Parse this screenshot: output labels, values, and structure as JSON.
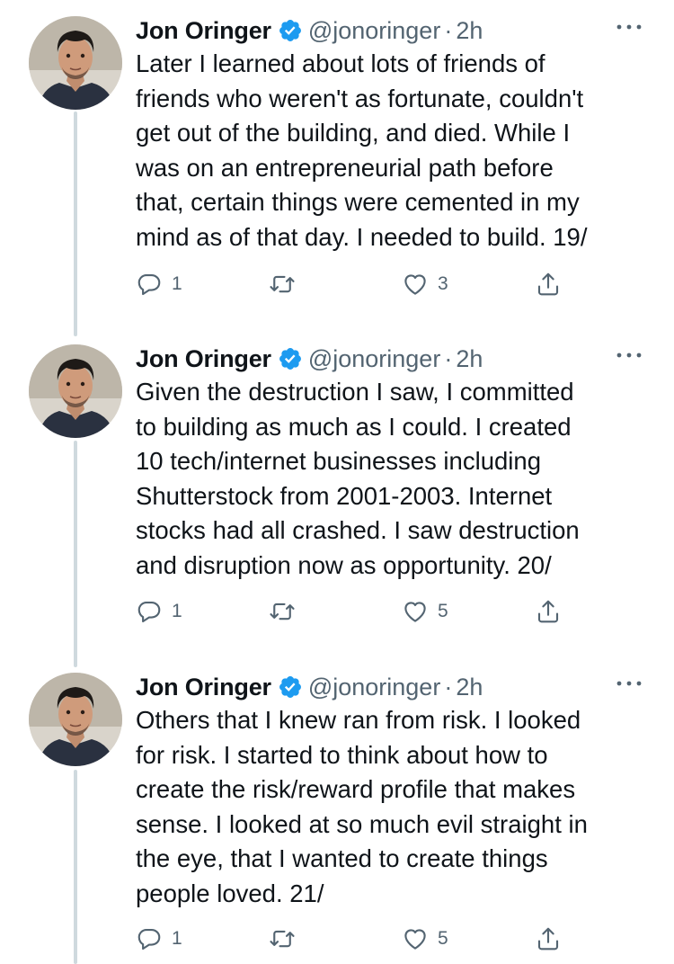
{
  "tweets": [
    {
      "author": "Jon Oringer",
      "handle": "@jonoringer",
      "separator": "·",
      "time": "2h",
      "text": "Later I learned about lots of friends of\nfriends who weren't as fortunate, couldn't\nget out of the building, and died. While I\nwas on an entrepreneurial path before\nthat, certain things were cemented in my\nmind as of that day. I needed to build. 19/",
      "replies": "1",
      "retweets": "",
      "likes": "3"
    },
    {
      "author": "Jon Oringer",
      "handle": "@jonoringer",
      "separator": "·",
      "time": "2h",
      "text": "Given the destruction I saw, I committed\nto building as much as I could. I created\n10 tech/internet businesses including\nShutterstock from 2001-2003. Internet\nstocks had all crashed. I saw destruction\nand disruption now as opportunity. 20/",
      "replies": "1",
      "retweets": "",
      "likes": "5"
    },
    {
      "author": "Jon Oringer",
      "handle": "@jonoringer",
      "separator": "·",
      "time": "2h",
      "text": "Others that I knew ran from risk. I looked\nfor risk. I started to think about how to\ncreate the risk/reward profile that makes\nsense. I looked at so much evil straight in\nthe eye, that I wanted to create things\npeople loved. 21/",
      "replies": "1",
      "retweets": "",
      "likes": "5"
    }
  ],
  "icons": {
    "verified": "verified-badge-icon",
    "more": "more-options-icon",
    "reply": "reply-icon",
    "retweet": "retweet-icon",
    "like": "like-icon",
    "share": "share-icon"
  },
  "colors": {
    "text": "#0f1419",
    "secondary": "#536471",
    "verified": "#1d9bf0",
    "thread_line": "#cfd9de"
  }
}
